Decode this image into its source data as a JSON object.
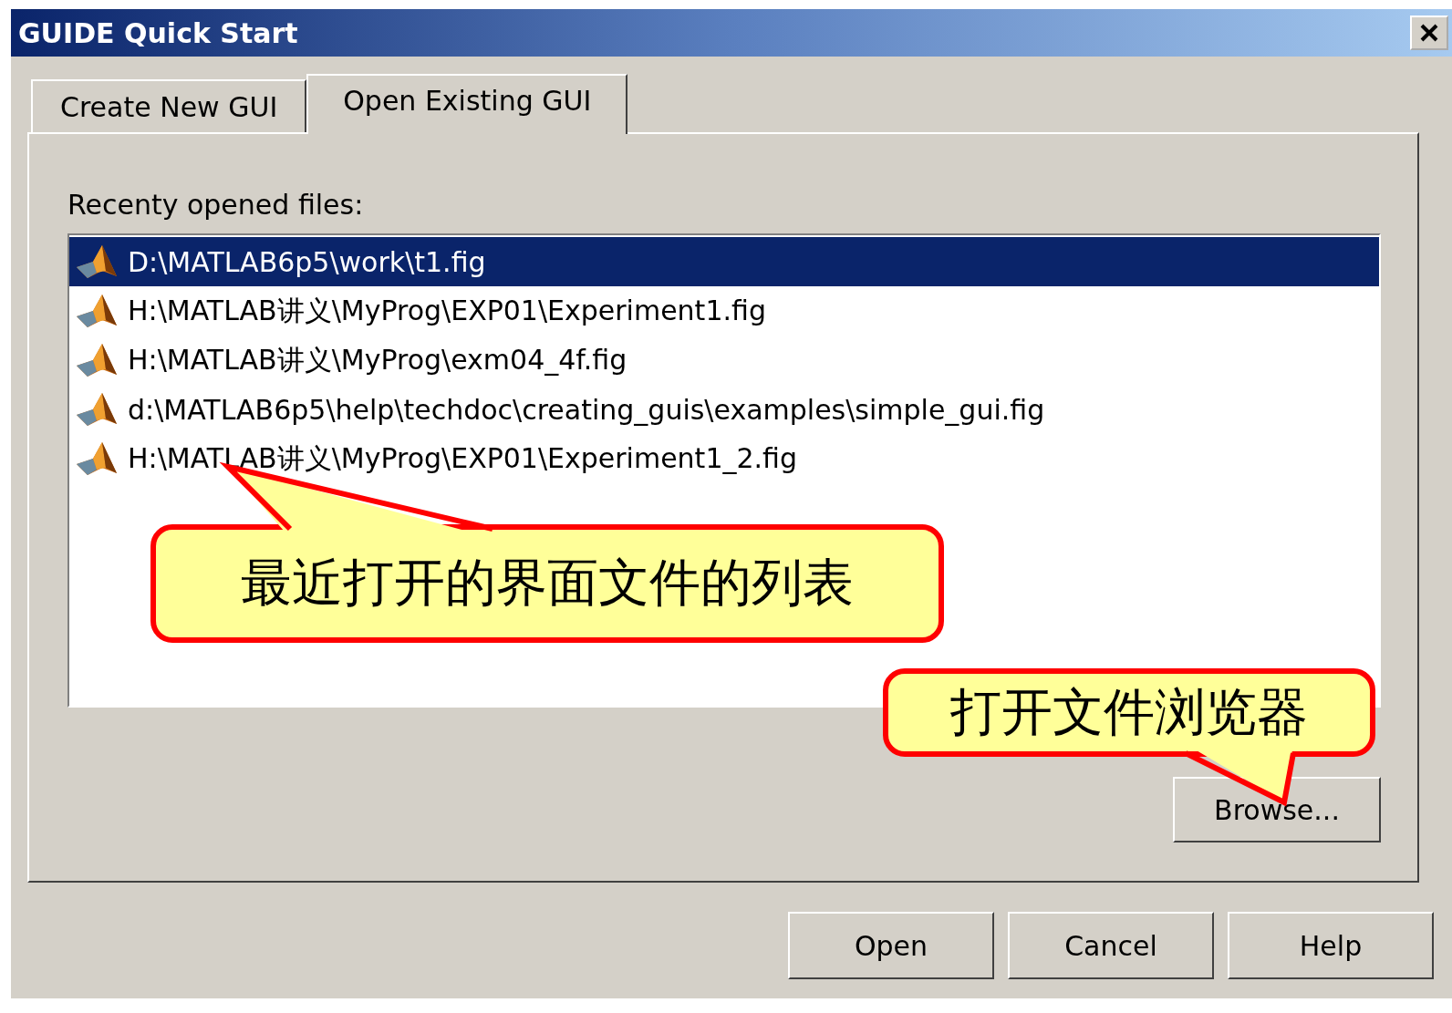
{
  "window": {
    "title": "GUIDE Quick Start"
  },
  "tabs": [
    {
      "label": "Create New GUI",
      "selected": false
    },
    {
      "label": "Open Existing GUI",
      "selected": true
    }
  ],
  "recent_files": {
    "label": "Recenty opened files:",
    "items": [
      {
        "path": "D:\\MATLAB6p5\\work\\t1.fig",
        "selected": true
      },
      {
        "path": "H:\\MATLAB讲义\\MyProg\\EXP01\\Experiment1.fig",
        "selected": false
      },
      {
        "path": "H:\\MATLAB讲义\\MyProg\\exm04_4f.fig",
        "selected": false
      },
      {
        "path": "d:\\MATLAB6p5\\help\\techdoc\\creating_guis\\examples\\simple_gui.fig",
        "selected": false
      },
      {
        "path": "H:\\MATLAB讲义\\MyProg\\EXP01\\Experiment1_2.fig",
        "selected": false
      }
    ]
  },
  "browse_button": "Browse...",
  "buttons": [
    "Open",
    "Cancel",
    "Help"
  ],
  "callouts": [
    {
      "text": "最近打开的界面文件的列表"
    },
    {
      "text": "打开文件浏览器"
    }
  ]
}
